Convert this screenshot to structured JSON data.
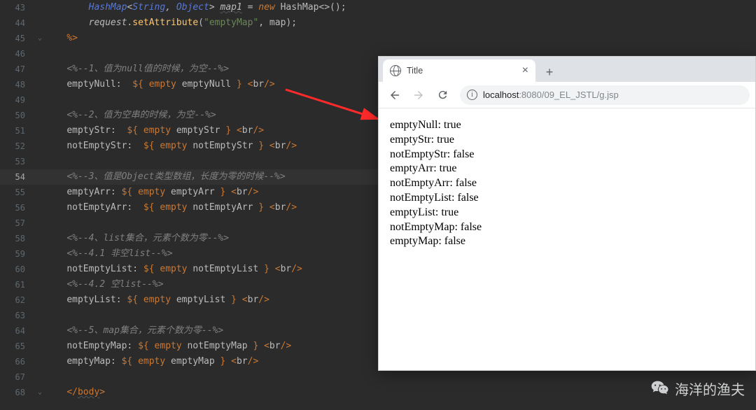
{
  "editor_lines": [
    {
      "n": "43",
      "fold": "",
      "indent": "        ",
      "tokens": [
        {
          "t": "HashMap",
          "c": "c-cls"
        },
        {
          "t": "<",
          "c": "c-op"
        },
        {
          "t": "String",
          "c": "c-cls"
        },
        {
          "t": ", ",
          "c": "c-op c-var"
        },
        {
          "t": "Object",
          "c": "c-cls"
        },
        {
          "t": "> ",
          "c": "c-op"
        },
        {
          "t": "map1",
          "c": "c-var c-wavy"
        },
        {
          "t": " = ",
          "c": "c-op"
        },
        {
          "t": "new ",
          "c": "c-kw"
        },
        {
          "t": "HashMap",
          "c": "c-plain"
        },
        {
          "t": "<>();",
          "c": "c-op"
        }
      ]
    },
    {
      "n": "44",
      "fold": "",
      "indent": "        ",
      "tokens": [
        {
          "t": "request",
          "c": "c-var"
        },
        {
          "t": ".",
          "c": "c-op"
        },
        {
          "t": "setAttribute",
          "c": "c-fn"
        },
        {
          "t": "(",
          "c": "c-op"
        },
        {
          "t": "\"emptyMap\"",
          "c": "c-str"
        },
        {
          "t": ", map);",
          "c": "c-op"
        }
      ]
    },
    {
      "n": "45",
      "fold": "⌄",
      "indent": "    ",
      "tokens": [
        {
          "t": "%>",
          "c": "c-tag"
        }
      ]
    },
    {
      "n": "46",
      "fold": "",
      "indent": "",
      "tokens": []
    },
    {
      "n": "47",
      "fold": "",
      "indent": "    ",
      "tokens": [
        {
          "t": "<%--1、值为null值的时候，为空--%>",
          "c": "c-cmt"
        }
      ]
    },
    {
      "n": "48",
      "fold": "",
      "indent": "    ",
      "tokens": [
        {
          "t": "emptyNull:  ",
          "c": "c-plain"
        },
        {
          "t": "${ ",
          "c": "c-el"
        },
        {
          "t": "empty ",
          "c": "c-el-kw"
        },
        {
          "t": "emptyNull ",
          "c": "c-plain"
        },
        {
          "t": "}",
          "c": "c-el"
        },
        {
          "t": " <",
          "c": "c-tag"
        },
        {
          "t": "br",
          "c": "c-close"
        },
        {
          "t": "/>",
          "c": "c-tag"
        }
      ]
    },
    {
      "n": "49",
      "fold": "",
      "indent": "",
      "tokens": []
    },
    {
      "n": "50",
      "fold": "",
      "indent": "    ",
      "tokens": [
        {
          "t": "<%--2、值为空串的时候，为空--%>",
          "c": "c-cmt"
        }
      ]
    },
    {
      "n": "51",
      "fold": "",
      "indent": "    ",
      "tokens": [
        {
          "t": "emptyStr:  ",
          "c": "c-plain"
        },
        {
          "t": "${ ",
          "c": "c-el"
        },
        {
          "t": "empty ",
          "c": "c-el-kw"
        },
        {
          "t": "emptyStr ",
          "c": "c-plain"
        },
        {
          "t": "}",
          "c": "c-el"
        },
        {
          "t": " <",
          "c": "c-tag"
        },
        {
          "t": "br",
          "c": "c-close"
        },
        {
          "t": "/>",
          "c": "c-tag"
        }
      ]
    },
    {
      "n": "52",
      "fold": "",
      "indent": "    ",
      "tokens": [
        {
          "t": "notEmptyStr:  ",
          "c": "c-plain"
        },
        {
          "t": "${ ",
          "c": "c-el"
        },
        {
          "t": "empty ",
          "c": "c-el-kw"
        },
        {
          "t": "notEmptyStr ",
          "c": "c-plain"
        },
        {
          "t": "}",
          "c": "c-el"
        },
        {
          "t": " <",
          "c": "c-tag"
        },
        {
          "t": "br",
          "c": "c-close"
        },
        {
          "t": "/>",
          "c": "c-tag"
        }
      ]
    },
    {
      "n": "53",
      "fold": "",
      "indent": "",
      "tokens": []
    },
    {
      "n": "54",
      "fold": "",
      "indent": "    ",
      "tokens": [
        {
          "t": "<%--3、值是Object类型数组，长度为零的时候--%>",
          "c": "c-cmt"
        }
      ],
      "hl": true
    },
    {
      "n": "55",
      "fold": "",
      "indent": "    ",
      "tokens": [
        {
          "t": "emptyArr: ",
          "c": "c-plain"
        },
        {
          "t": "${ ",
          "c": "c-el"
        },
        {
          "t": "empty ",
          "c": "c-el-kw"
        },
        {
          "t": "emptyArr ",
          "c": "c-plain"
        },
        {
          "t": "}",
          "c": "c-el"
        },
        {
          "t": " <",
          "c": "c-tag"
        },
        {
          "t": "br",
          "c": "c-close"
        },
        {
          "t": "/>",
          "c": "c-tag"
        }
      ]
    },
    {
      "n": "56",
      "fold": "",
      "indent": "    ",
      "tokens": [
        {
          "t": "notEmptyArr:  ",
          "c": "c-plain"
        },
        {
          "t": "${ ",
          "c": "c-el"
        },
        {
          "t": "empty ",
          "c": "c-el-kw"
        },
        {
          "t": "notEmptyArr ",
          "c": "c-plain"
        },
        {
          "t": "}",
          "c": "c-el"
        },
        {
          "t": " <",
          "c": "c-tag"
        },
        {
          "t": "br",
          "c": "c-close"
        },
        {
          "t": "/>",
          "c": "c-tag"
        }
      ]
    },
    {
      "n": "57",
      "fold": "",
      "indent": "",
      "tokens": []
    },
    {
      "n": "58",
      "fold": "",
      "indent": "    ",
      "tokens": [
        {
          "t": "<%--4、list集合，元素个数为零--%>",
          "c": "c-cmt"
        }
      ]
    },
    {
      "n": "59",
      "fold": "",
      "indent": "    ",
      "tokens": [
        {
          "t": "<%--4.1 非空list--%>",
          "c": "c-cmt"
        }
      ]
    },
    {
      "n": "60",
      "fold": "",
      "indent": "    ",
      "tokens": [
        {
          "t": "notEmptyList: ",
          "c": "c-plain"
        },
        {
          "t": "${ ",
          "c": "c-el"
        },
        {
          "t": "empty ",
          "c": "c-el-kw"
        },
        {
          "t": "notEmptyList ",
          "c": "c-plain"
        },
        {
          "t": "}",
          "c": "c-el"
        },
        {
          "t": " <",
          "c": "c-tag"
        },
        {
          "t": "br",
          "c": "c-close"
        },
        {
          "t": "/>",
          "c": "c-tag"
        }
      ]
    },
    {
      "n": "61",
      "fold": "",
      "indent": "    ",
      "tokens": [
        {
          "t": "<%--4.2 空list--%>",
          "c": "c-cmt"
        }
      ]
    },
    {
      "n": "62",
      "fold": "",
      "indent": "    ",
      "tokens": [
        {
          "t": "emptyList: ",
          "c": "c-plain"
        },
        {
          "t": "${ ",
          "c": "c-el"
        },
        {
          "t": "empty ",
          "c": "c-el-kw"
        },
        {
          "t": "emptyList ",
          "c": "c-plain"
        },
        {
          "t": "}",
          "c": "c-el"
        },
        {
          "t": " <",
          "c": "c-tag"
        },
        {
          "t": "br",
          "c": "c-close"
        },
        {
          "t": "/>",
          "c": "c-tag"
        }
      ]
    },
    {
      "n": "63",
      "fold": "",
      "indent": "",
      "tokens": []
    },
    {
      "n": "64",
      "fold": "",
      "indent": "    ",
      "tokens": [
        {
          "t": "<%--5、map集合，元素个数为零--%>",
          "c": "c-cmt"
        }
      ]
    },
    {
      "n": "65",
      "fold": "",
      "indent": "    ",
      "tokens": [
        {
          "t": "notEmptyMap: ",
          "c": "c-plain"
        },
        {
          "t": "${ ",
          "c": "c-el"
        },
        {
          "t": "empty ",
          "c": "c-el-kw"
        },
        {
          "t": "notEmptyMap ",
          "c": "c-plain"
        },
        {
          "t": "}",
          "c": "c-el"
        },
        {
          "t": " <",
          "c": "c-tag"
        },
        {
          "t": "br",
          "c": "c-close"
        },
        {
          "t": "/>",
          "c": "c-tag"
        }
      ]
    },
    {
      "n": "66",
      "fold": "",
      "indent": "    ",
      "tokens": [
        {
          "t": "emptyMap: ",
          "c": "c-plain"
        },
        {
          "t": "${ ",
          "c": "c-el"
        },
        {
          "t": "empty ",
          "c": "c-el-kw"
        },
        {
          "t": "emptyMap ",
          "c": "c-plain"
        },
        {
          "t": "}",
          "c": "c-el"
        },
        {
          "t": " <",
          "c": "c-tag"
        },
        {
          "t": "br",
          "c": "c-close"
        },
        {
          "t": "/>",
          "c": "c-tag"
        }
      ]
    },
    {
      "n": "67",
      "fold": "",
      "indent": "",
      "tokens": []
    },
    {
      "n": "68",
      "fold": "⌄",
      "indent": "    ",
      "tokens": [
        {
          "t": "</",
          "c": "c-tag"
        },
        {
          "t": "body",
          "c": "c-tag c-wavy"
        },
        {
          "t": ">",
          "c": "c-tag"
        }
      ]
    }
  ],
  "browser": {
    "tab_title": "Title",
    "url_host": "localhost",
    "url_port": ":8080",
    "url_path": "/09_EL_JSTL/g.jsp",
    "output": [
      "emptyNull: true",
      "emptyStr: true",
      "notEmptyStr: false",
      "emptyArr: true",
      "notEmptyArr: false",
      "notEmptyList: false",
      "emptyList: true",
      "notEmptyMap: false",
      "emptyMap: false"
    ]
  },
  "watermark_text": "海洋的渔夫"
}
